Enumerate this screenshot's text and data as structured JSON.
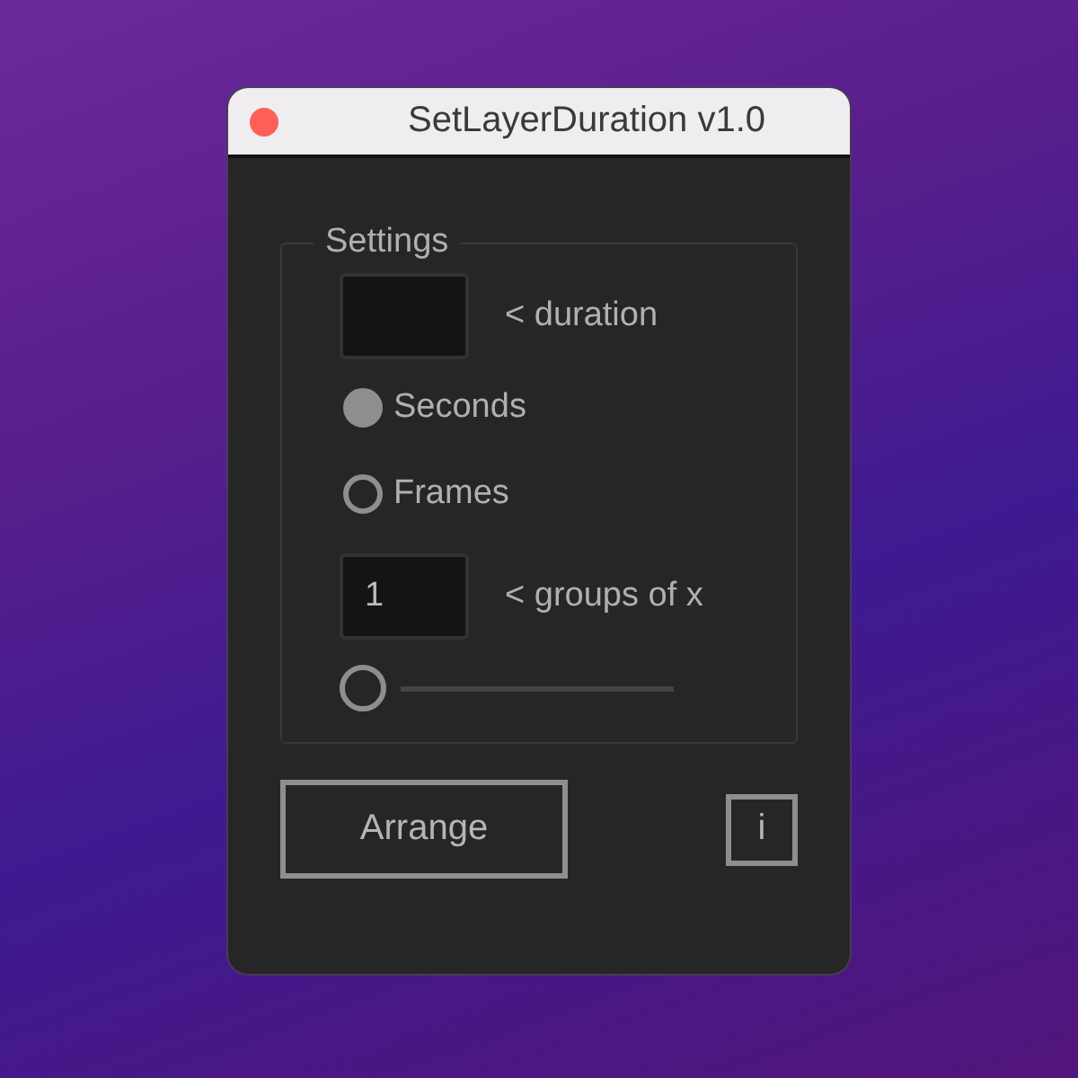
{
  "window": {
    "title": "SetLayerDuration v1.0"
  },
  "settings": {
    "title": "Settings",
    "duration_field": {
      "label": "< duration"
    },
    "units": [
      {
        "label": "Seconds",
        "selected": true
      },
      {
        "label": "Frames",
        "selected": false
      }
    ],
    "groups_field": {
      "value": "1",
      "label": "< groups of x"
    },
    "slider": {
      "level": 0
    }
  },
  "buttons": [
    {
      "label": "Arrange",
      "kind": "wide"
    },
    {
      "label": "i",
      "kind": "info"
    }
  ]
}
